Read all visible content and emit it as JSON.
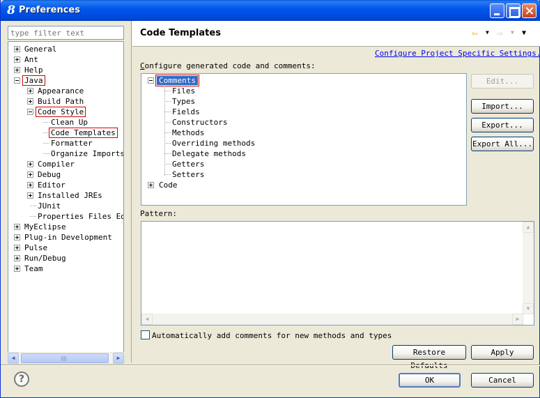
{
  "window": {
    "title": "Preferences",
    "icon": "eclipse-8-icon"
  },
  "left": {
    "filter_placeholder": "type filter text",
    "tree": [
      {
        "label": "General",
        "level": 0,
        "expander": "plus"
      },
      {
        "label": "Ant",
        "level": 0,
        "expander": "plus"
      },
      {
        "label": "Help",
        "level": 0,
        "expander": "plus"
      },
      {
        "label": "Java",
        "level": 0,
        "expander": "minus",
        "highlight": true
      },
      {
        "label": "Appearance",
        "level": 1,
        "expander": "plus"
      },
      {
        "label": "Build Path",
        "level": 1,
        "expander": "plus"
      },
      {
        "label": "Code Style",
        "level": 1,
        "expander": "minus",
        "highlight": true
      },
      {
        "label": "Clean Up",
        "level": 2,
        "expander": "none"
      },
      {
        "label": "Code Templates",
        "level": 2,
        "expander": "none",
        "highlight": true,
        "selected": true
      },
      {
        "label": "Formatter",
        "level": 2,
        "expander": "none"
      },
      {
        "label": "Organize Imports",
        "level": 2,
        "expander": "none"
      },
      {
        "label": "Compiler",
        "level": 1,
        "expander": "plus"
      },
      {
        "label": "Debug",
        "level": 1,
        "expander": "plus"
      },
      {
        "label": "Editor",
        "level": 1,
        "expander": "plus"
      },
      {
        "label": "Installed JREs",
        "level": 1,
        "expander": "plus"
      },
      {
        "label": "JUnit",
        "level": 1,
        "expander": "none"
      },
      {
        "label": "Properties Files Edit",
        "level": 1,
        "expander": "none"
      },
      {
        "label": "MyEclipse",
        "level": 0,
        "expander": "plus"
      },
      {
        "label": "Plug-in Development",
        "level": 0,
        "expander": "plus"
      },
      {
        "label": "Pulse",
        "level": 0,
        "expander": "plus"
      },
      {
        "label": "Run/Debug",
        "level": 0,
        "expander": "plus"
      },
      {
        "label": "Team",
        "level": 0,
        "expander": "plus"
      }
    ],
    "scroll_thumb_grip": "III"
  },
  "right": {
    "page_title": "Code Templates",
    "config_link": "Configure Project Specific Settings...",
    "config_label": "Configure generated code and comments:",
    "templates": {
      "comments_label": "Comments",
      "comment_children": [
        "Files",
        "Types",
        "Fields",
        "Constructors",
        "Methods",
        "Overriding methods",
        "Delegate methods",
        "Getters",
        "Setters"
      ],
      "code_label": "Code"
    },
    "buttons": {
      "edit": "Edit...",
      "import": "Import...",
      "export": "Export...",
      "export_all": "Export All..."
    },
    "pattern_label": "Pattern:",
    "auto_comments_label": "Automatically add comments for new methods and types",
    "auto_comments_checked": false,
    "restore_defaults": "Restore Defaults",
    "apply": "Apply"
  },
  "footer": {
    "ok": "OK",
    "cancel": "Cancel",
    "help_glyph": "?"
  }
}
